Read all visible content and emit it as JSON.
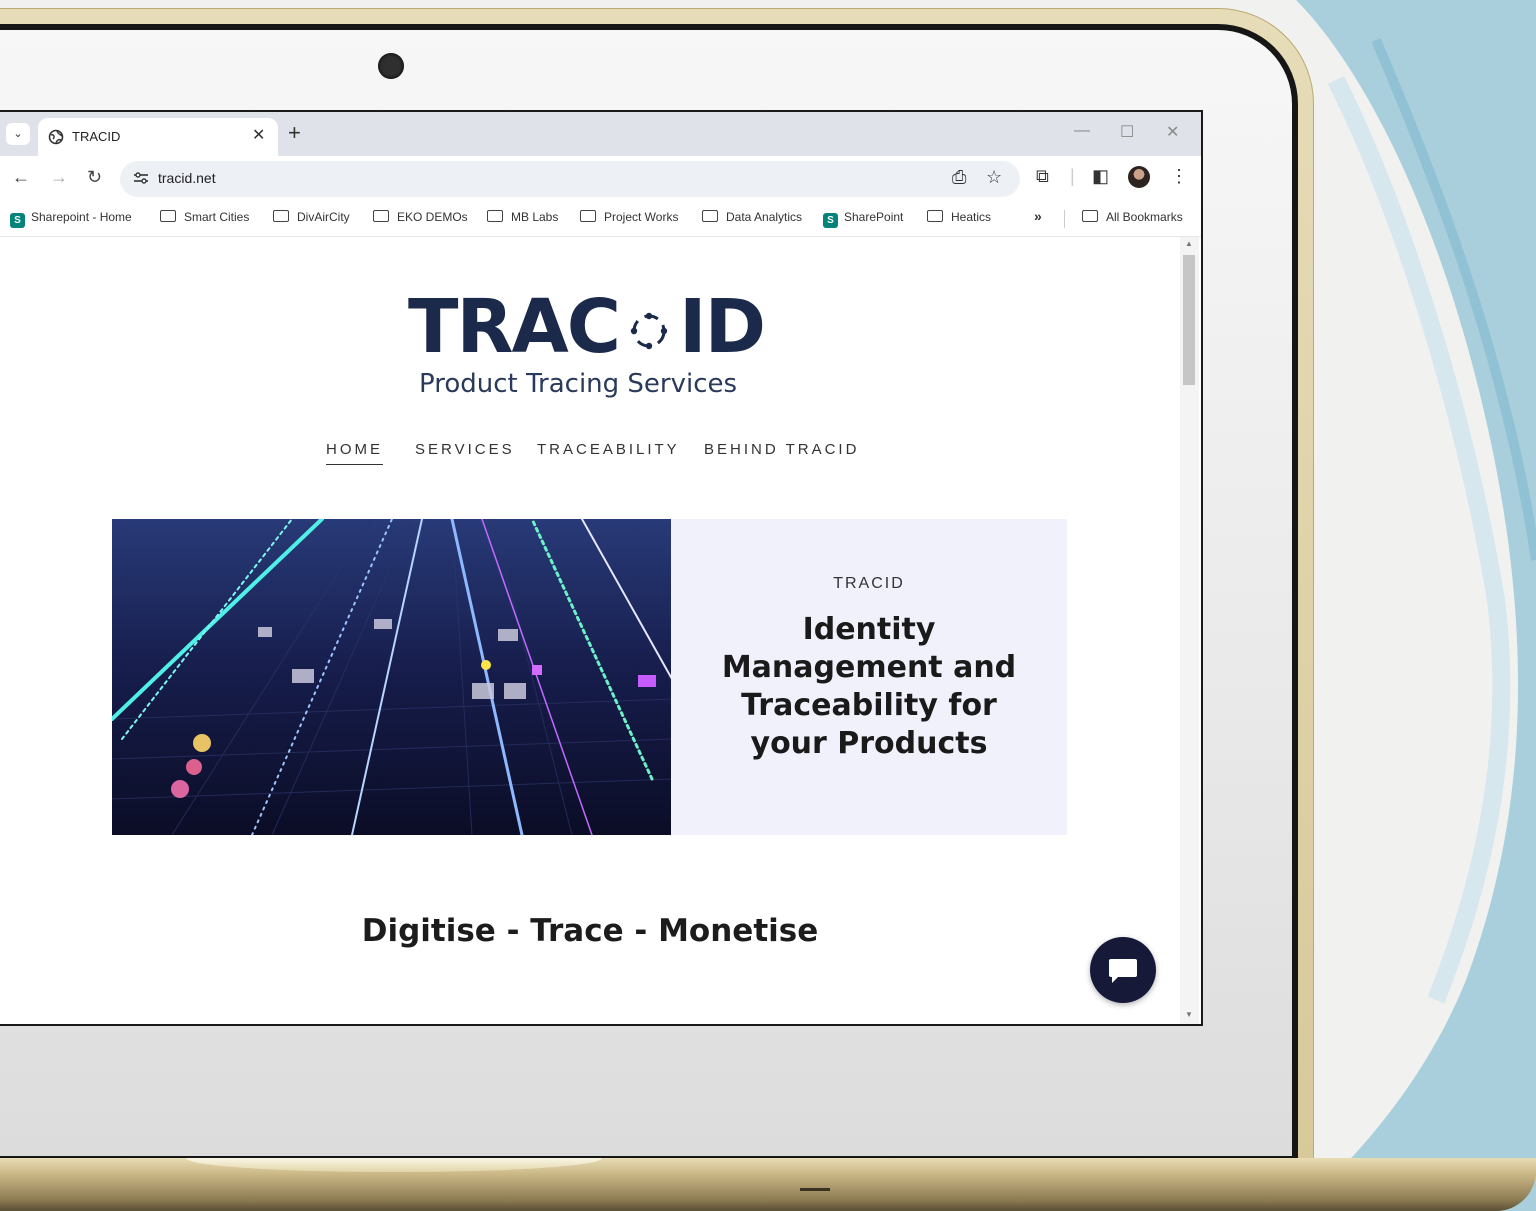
{
  "browser": {
    "tab_title": "TRACID",
    "url": "tracid.net",
    "bookmarks": [
      {
        "label": "Sharepoint - Home",
        "type": "sharepoint"
      },
      {
        "label": "Smart Cities",
        "type": "folder"
      },
      {
        "label": "DivAirCity",
        "type": "folder"
      },
      {
        "label": "EKO DEMOs",
        "type": "folder"
      },
      {
        "label": "MB Labs",
        "type": "folder"
      },
      {
        "label": "Project Works",
        "type": "folder"
      },
      {
        "label": "Data Analytics",
        "type": "folder"
      },
      {
        "label": "SharePoint",
        "type": "sharepoint"
      },
      {
        "label": "Heatics",
        "type": "folder"
      }
    ],
    "all_bookmarks": "All Bookmarks",
    "overflow": "»"
  },
  "site": {
    "logo_left": "TRAC",
    "logo_right": "ID",
    "logo_tagline": "Product Tracing Services",
    "nav": [
      {
        "label": "HOME",
        "active": true
      },
      {
        "label": "SERVICES",
        "active": false
      },
      {
        "label": "TRACEABILITY",
        "active": false
      },
      {
        "label": "BEHIND TRACID",
        "active": false
      }
    ],
    "hero_kicker": "TRACID",
    "hero_headline": "Identity Management and Traceability for your Products",
    "tagline": "Digitise - Trace - Monetise"
  },
  "colors": {
    "brand_navy": "#1b2a4a",
    "chat_button": "#161a38",
    "hero_panel": "#f0f1fb",
    "laptop_gold": "#d7c99a",
    "paint_blue": "#a9cfdd"
  }
}
